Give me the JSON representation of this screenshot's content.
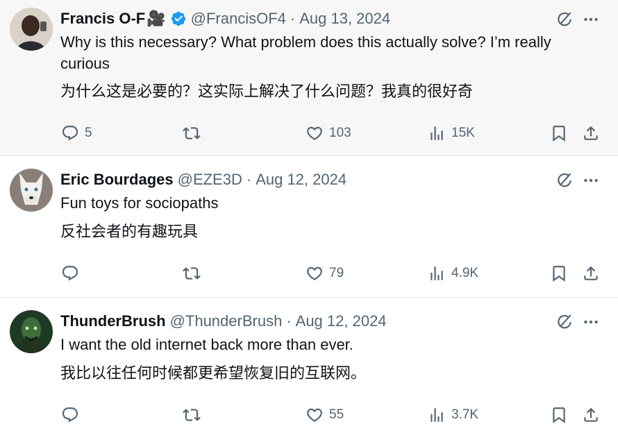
{
  "replies": [
    {
      "name": "Francis O-F",
      "name_emoji": "🎥",
      "verified": true,
      "handle": "@FrancisOF4",
      "separator": "·",
      "date": "Aug 13, 2024",
      "text_en": "Why is this necessary? What problem does this actually solve? I’m really curious",
      "text_zh": "为什么这是必要的？这实际上解决了什么问题？我真的很好奇",
      "stats": {
        "replies": "5",
        "retweets": "",
        "likes": "103",
        "views": "15K"
      }
    },
    {
      "name": "Eric Bourdages",
      "verified": false,
      "handle": "@EZE3D",
      "separator": "·",
      "date": "Aug 12, 2024",
      "text_en": "Fun toys for sociopaths",
      "text_zh": "反社会者的有趣玩具",
      "stats": {
        "replies": "",
        "retweets": "",
        "likes": "79",
        "views": "4.9K"
      }
    },
    {
      "name": "ThunderBrush",
      "verified": false,
      "handle": "@ThunderBrush",
      "separator": "·",
      "date": "Aug 12, 2024",
      "text_en": "I want the old internet back more than ever.",
      "text_zh": "我比以往任何时候都更希望恢复旧的互联网。",
      "stats": {
        "replies": "",
        "retweets": "",
        "likes": "55",
        "views": "3.7K"
      }
    }
  ],
  "icons": {
    "reply": "reply-icon",
    "retweet": "retweet-icon",
    "like": "heart-icon",
    "views": "views-icon",
    "bookmark": "bookmark-icon",
    "share": "share-icon",
    "grok": "grok-icon",
    "more": "more-icon",
    "verified": "verified-badge-icon"
  },
  "colors": {
    "text_primary": "#0f1419",
    "text_secondary": "#536471",
    "verified_blue": "#1d9bf0",
    "highlight_bg": "#f7f7f7"
  }
}
